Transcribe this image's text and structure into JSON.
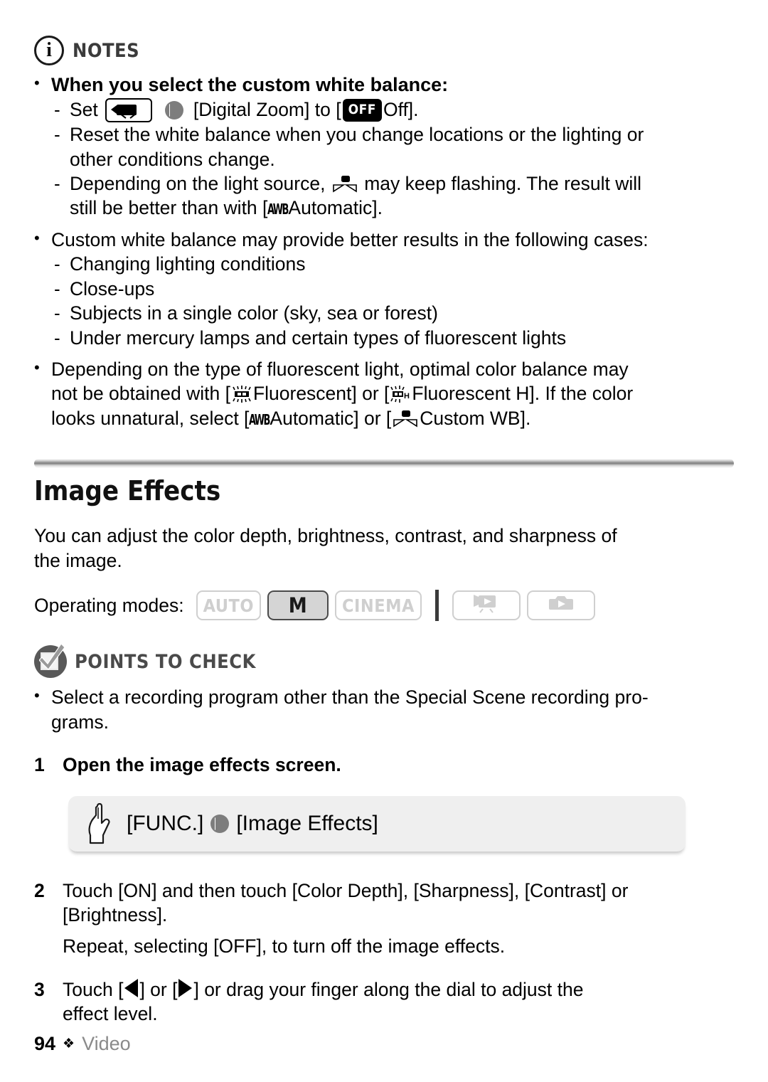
{
  "notes": {
    "icon": "info-circle-icon",
    "title": "NOTES",
    "bullets": [
      {
        "bold": true,
        "text": "When you select the custom white balance:",
        "subitems": [
          {
            "pre": "Set",
            "icon1": "camcorder-menu-icon",
            "arrow": "double-chevron-icon",
            "mid": "[Digital Zoom] to [",
            "badge": "OFF",
            "post": "Off]."
          },
          {
            "lines": [
              "Reset the white balance when you change locations or the lighting or",
              "other conditions change."
            ]
          },
          {
            "lines_rich": true,
            "pre": "Depending on the light source,",
            "icon": "custom-wb-icon",
            "post": "may keep flashing. The result will",
            "line2pre": "still be better than with [",
            "line2icon": "awb-icon",
            "line2post": "Automatic]."
          }
        ]
      },
      {
        "bold": false,
        "text": "Custom white balance may provide better results in the following cases:",
        "subitems": [
          {
            "lines": [
              "Changing lighting conditions"
            ]
          },
          {
            "lines": [
              "Close-ups"
            ]
          },
          {
            "lines": [
              "Subjects in a single color (sky, sea or forest)"
            ]
          },
          {
            "lines": [
              "Under mercury lamps and certain types of fluorescent lights"
            ]
          }
        ]
      },
      {
        "bold": false,
        "fluorescent": true,
        "line1": "Depending on the type of fluorescent light, optimal color balance may",
        "line2a": "not be obtained with [",
        "fluo_icon": "fluorescent-icon",
        "line2b": "Fluorescent] or [",
        "fluoh_icon": "fluorescent-h-icon",
        "line2c": "Fluorescent H]. If the color",
        "line3a": "looks unnatural, select [",
        "awb_icon": "awb-icon",
        "line3b": "Automatic] or [",
        "cwb_icon": "custom-wb-icon",
        "line3c": "Custom WB]."
      }
    ]
  },
  "section": {
    "title": "Image Effects",
    "intro_line1": "You can adjust the color depth, brightness, contrast, and sharpness of",
    "intro_line2": "the image."
  },
  "operating_modes": {
    "label": "Operating modes:",
    "modes": [
      {
        "name": "auto",
        "label": "AUTO",
        "active": false,
        "type": "text"
      },
      {
        "name": "manual",
        "label": "M",
        "active": true,
        "type": "text"
      },
      {
        "name": "cinema",
        "label": "CINEMA",
        "active": false,
        "type": "text"
      },
      {
        "name": "video-playback",
        "label": "",
        "active": false,
        "type": "icon",
        "icon": "camcorder-play-icon"
      },
      {
        "name": "photo-playback",
        "label": "",
        "active": false,
        "type": "icon",
        "icon": "camera-play-icon"
      }
    ]
  },
  "points_to_check": {
    "icon": "checkbox-check-icon",
    "title": "POINTS TO CHECK",
    "bullet_line1": "Select a recording program other than the Special Scene recording pro-",
    "bullet_line2": "grams."
  },
  "steps": [
    {
      "num": "1",
      "bold_text": "Open the image effects screen.",
      "func_box": {
        "icon": "pointing-hand-icon",
        "func_label": "[FUNC.]",
        "arrow": "double-chevron-icon",
        "target_label": "[Image Effects]"
      }
    },
    {
      "num": "2",
      "line1": "Touch [ON] and then touch [Color Depth], [Sharpness], [Contrast] or",
      "line2": "[Brightness].",
      "sub": "Repeat, selecting [OFF], to turn off the image effects."
    },
    {
      "num": "3",
      "pre": "Touch [",
      "tri_left": "left-triangle-icon",
      "mid": "] or [",
      "tri_right": "right-triangle-icon",
      "post": "] or drag your finger along the dial to adjust the",
      "line2": "effect level."
    }
  ],
  "footer": {
    "page_number": "94",
    "diamond": "❖",
    "section_name": "Video"
  },
  "colors": {
    "text": "#000000",
    "muted": "#8a8a8a",
    "heading_gray": "#4a4a4a",
    "mode_inactive": "#cfcfcf",
    "mode_active_bg": "#d5d5d5",
    "func_box_bg": "#efefef",
    "badge_bg": "#000000"
  }
}
